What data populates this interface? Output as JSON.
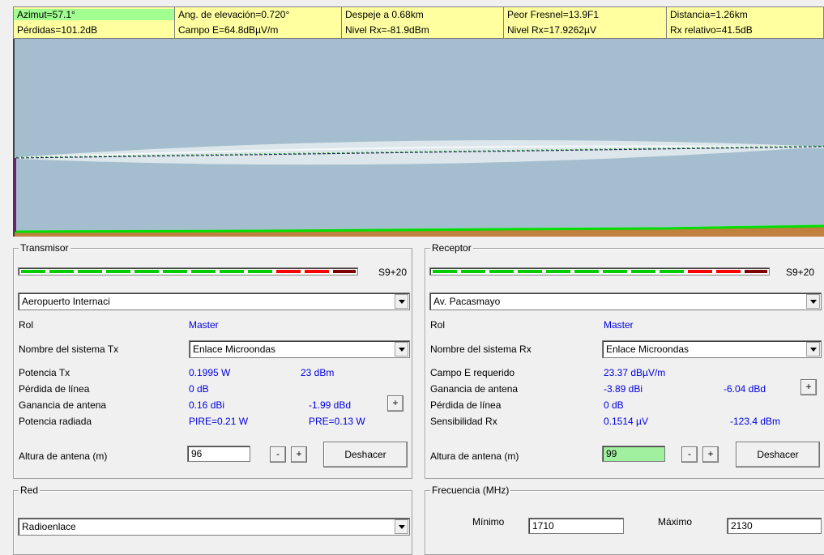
{
  "info": {
    "row1": [
      "Azimut=57.1°",
      "Ang. de elevación=0.720°",
      "Despeje a 0.68km",
      "Peor Fresnel=13.9F1",
      "Distancia=1.26km"
    ],
    "row2": [
      "Pérdidas=101.2dB",
      "Campo E=64.8dBµV/m",
      "Nivel Rx=-81.9dBm",
      "Nivel Rx=17.9262µV",
      "Rx relativo=41.5dB"
    ]
  },
  "profile": {
    "sky_color": "#a4becf",
    "terrain_line_color": "#00e000",
    "ground_color": "#c08040",
    "fresnel_color": "#e8eef0",
    "los_color": "#203050"
  },
  "transmitter": {
    "title": "Transmisor",
    "meter_label": "S9+20",
    "meter_level_fraction": 1.0,
    "station": "Aeropuerto Internaci",
    "rol_label": "Rol",
    "rol_value": "Master",
    "system_label": "Nombre del sistema Tx",
    "system_value": "Enlace Microondas",
    "power_label": "Potencia Tx",
    "power_w": "0.1995 W",
    "power_dbm": "23 dBm",
    "line_loss_label": "Pérdida de línea",
    "line_loss_value": "0 dB",
    "gain_label": "Ganancia de antena",
    "gain_dbi": "0.16 dBi",
    "gain_dbd": "-1.99 dBd",
    "radiated_label": "Potencia radiada",
    "pire": "PIRE=0.21 W",
    "pre": "PRE=0.13 W",
    "height_label": "Altura de antena (m)",
    "height_value": "96",
    "minus": "-",
    "plus": "+",
    "undo": "Deshacer"
  },
  "receiver": {
    "title": "Receptor",
    "meter_label": "S9+20",
    "meter_level_fraction": 1.0,
    "station": "Av. Pacasmayo",
    "rol_label": "Rol",
    "rol_value": "Master",
    "system_label": "Nombre del sistema Rx",
    "system_value": "Enlace Microondas",
    "field_label": "Campo E requerido",
    "field_value": "23.37 dBµV/m",
    "gain_label": "Ganancia de antena",
    "gain_dbi": "-3.89 dBi",
    "gain_dbd": "-6.04 dBd",
    "line_loss_label": "Pérdida de línea",
    "line_loss_value": "0 dB",
    "sens_label": "Sensibilidad Rx",
    "sens_uv": "0.1514 µV",
    "sens_dbm": "-123.4 dBm",
    "height_label": "Altura de antena (m)",
    "height_value": "99",
    "minus": "-",
    "plus": "+",
    "undo": "Deshacer"
  },
  "network": {
    "title": "Red",
    "value": "Radioenlace"
  },
  "frequency": {
    "title": "Frecuencia (MHz)",
    "min_label": "Mínimo",
    "min_value": "1710",
    "max_label": "Máximo",
    "max_value": "2130"
  }
}
